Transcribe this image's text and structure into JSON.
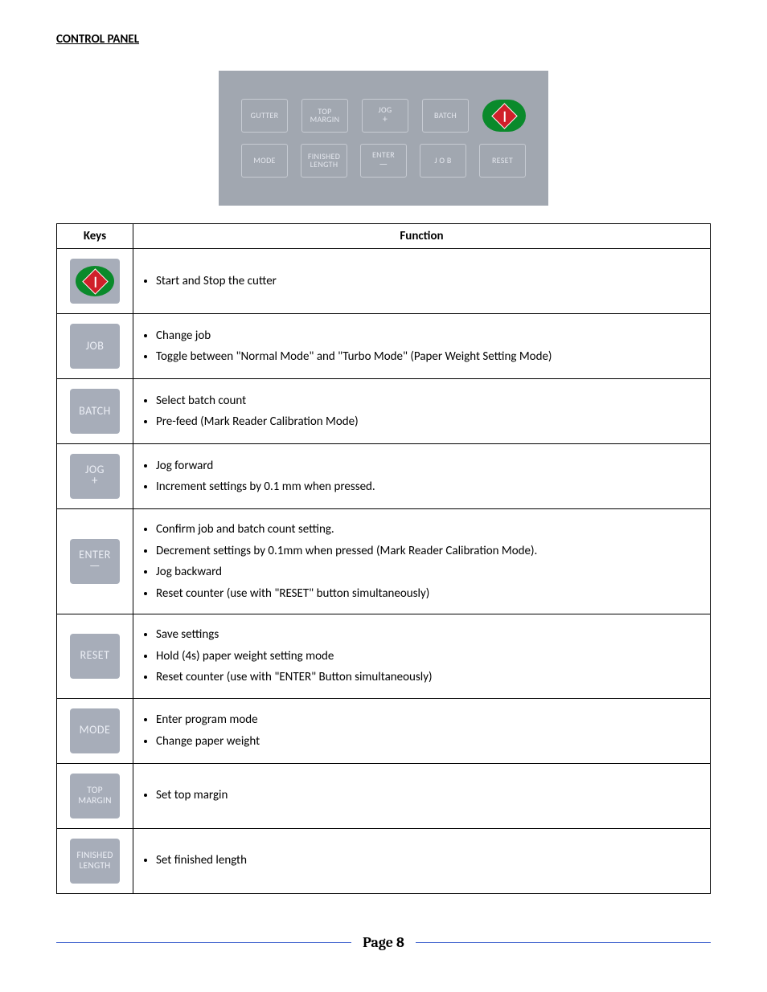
{
  "section_title": "CONTROL PANEL",
  "table": {
    "header_keys": "Keys",
    "header_function": "Function"
  },
  "panel_keys": {
    "gutter": "GUTTER",
    "top_margin_l1": "TOP",
    "top_margin_l2": "MARGIN",
    "jog": "JOG",
    "jog_plus": "+",
    "batch": "BATCH",
    "mode": "MODE",
    "finished_l1": "FINISHED",
    "finished_l2": "LENGTH",
    "enter": "ENTER",
    "enter_minus": "—",
    "job": "J O B",
    "reset": "RESET"
  },
  "keys": {
    "job": "JOB",
    "batch": "BATCH",
    "jog": "JOG",
    "jog_plus": "+",
    "enter": "ENTER",
    "enter_minus": "—",
    "reset": "RESET",
    "mode": "MODE",
    "top_margin_l1": "TOP",
    "top_margin_l2": "MARGIN",
    "finished_l1": "FINISHED",
    "finished_l2": "LENGTH"
  },
  "rows": [
    {
      "icon": "start-stop",
      "items": [
        "Start and Stop the cutter"
      ]
    },
    {
      "icon": "job",
      "items": [
        "Change job",
        "Toggle between \"Normal Mode\" and \"Turbo Mode\" (Paper Weight Setting Mode)"
      ]
    },
    {
      "icon": "batch",
      "items": [
        "Select batch count",
        "Pre-feed (Mark Reader Calibration Mode)"
      ]
    },
    {
      "icon": "jog",
      "items": [
        "Jog forward",
        "Increment settings by 0.1 mm when pressed."
      ]
    },
    {
      "icon": "enter",
      "items": [
        "Confirm job and batch count setting.",
        "Decrement settings by 0.1mm when pressed (Mark Reader Calibration Mode).",
        "Jog backward",
        "Reset counter (use with \"RESET\" button simultaneously)"
      ]
    },
    {
      "icon": "reset",
      "items": [
        "Save settings",
        "Hold (4s) paper weight setting mode",
        "Reset counter (use with \"ENTER\" Button simultaneously)"
      ]
    },
    {
      "icon": "mode",
      "items": [
        "Enter program mode",
        "Change paper weight"
      ]
    },
    {
      "icon": "top-margin",
      "items": [
        "Set top margin"
      ]
    },
    {
      "icon": "finished-length",
      "items": [
        "Set finished length"
      ]
    }
  ],
  "footer": {
    "page_label": "Page 8"
  }
}
